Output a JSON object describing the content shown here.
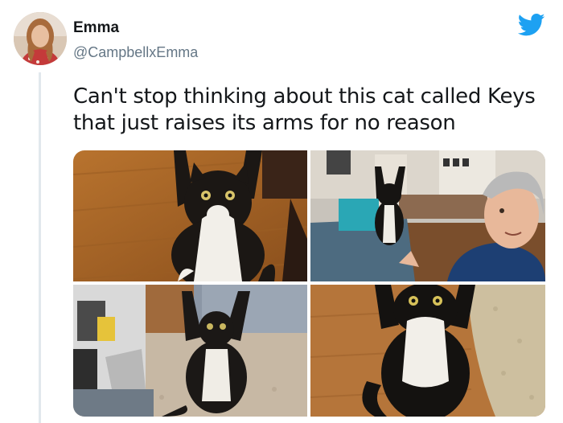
{
  "author": {
    "name": "Emma",
    "handle": "@CampbellxEmma",
    "avatar_icon": "avatar-woman-photo"
  },
  "brand": {
    "icon": "twitter-bird-icon",
    "color": "#1da1f2"
  },
  "tweet": {
    "text_line1": "Can't stop thinking about this cat called Keys",
    "text_line2": "that just raises its arms for no reason"
  },
  "media": {
    "count": 4,
    "photos": [
      {
        "subject": "cat-on-wood-floor-arms-raised"
      },
      {
        "subject": "cat-on-chair-with-man-selfie"
      },
      {
        "subject": "cat-by-desk-arms-raised"
      },
      {
        "subject": "cat-on-rug-arms-raised"
      }
    ]
  },
  "colors": {
    "text_primary": "#14171a",
    "text_secondary": "#657786",
    "thread_line": "#e1e8ed"
  }
}
